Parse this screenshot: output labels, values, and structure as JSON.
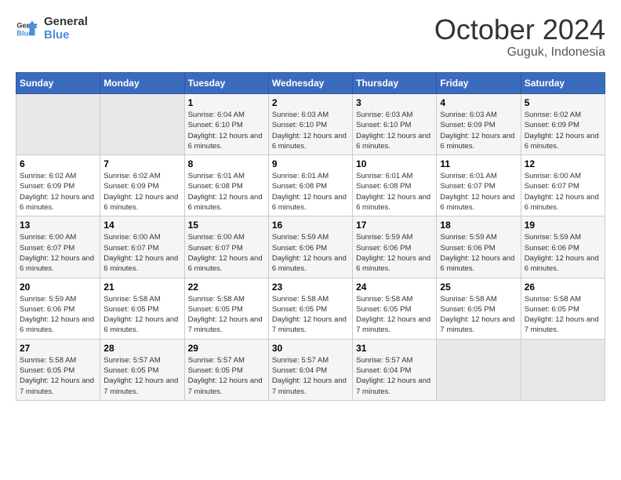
{
  "header": {
    "logo_line1": "General",
    "logo_line2": "Blue",
    "month": "October 2024",
    "location": "Guguk, Indonesia"
  },
  "days_of_week": [
    "Sunday",
    "Monday",
    "Tuesday",
    "Wednesday",
    "Thursday",
    "Friday",
    "Saturday"
  ],
  "weeks": [
    [
      {
        "day": "",
        "empty": true
      },
      {
        "day": "",
        "empty": true
      },
      {
        "day": "1",
        "sunrise": "6:04 AM",
        "sunset": "6:10 PM",
        "daylight": "12 hours and 6 minutes."
      },
      {
        "day": "2",
        "sunrise": "6:03 AM",
        "sunset": "6:10 PM",
        "daylight": "12 hours and 6 minutes."
      },
      {
        "day": "3",
        "sunrise": "6:03 AM",
        "sunset": "6:10 PM",
        "daylight": "12 hours and 6 minutes."
      },
      {
        "day": "4",
        "sunrise": "6:03 AM",
        "sunset": "6:09 PM",
        "daylight": "12 hours and 6 minutes."
      },
      {
        "day": "5",
        "sunrise": "6:02 AM",
        "sunset": "6:09 PM",
        "daylight": "12 hours and 6 minutes."
      }
    ],
    [
      {
        "day": "6",
        "sunrise": "6:02 AM",
        "sunset": "6:09 PM",
        "daylight": "12 hours and 6 minutes."
      },
      {
        "day": "7",
        "sunrise": "6:02 AM",
        "sunset": "6:09 PM",
        "daylight": "12 hours and 6 minutes."
      },
      {
        "day": "8",
        "sunrise": "6:01 AM",
        "sunset": "6:08 PM",
        "daylight": "12 hours and 6 minutes."
      },
      {
        "day": "9",
        "sunrise": "6:01 AM",
        "sunset": "6:08 PM",
        "daylight": "12 hours and 6 minutes."
      },
      {
        "day": "10",
        "sunrise": "6:01 AM",
        "sunset": "6:08 PM",
        "daylight": "12 hours and 6 minutes."
      },
      {
        "day": "11",
        "sunrise": "6:01 AM",
        "sunset": "6:07 PM",
        "daylight": "12 hours and 6 minutes."
      },
      {
        "day": "12",
        "sunrise": "6:00 AM",
        "sunset": "6:07 PM",
        "daylight": "12 hours and 6 minutes."
      }
    ],
    [
      {
        "day": "13",
        "sunrise": "6:00 AM",
        "sunset": "6:07 PM",
        "daylight": "12 hours and 6 minutes."
      },
      {
        "day": "14",
        "sunrise": "6:00 AM",
        "sunset": "6:07 PM",
        "daylight": "12 hours and 6 minutes."
      },
      {
        "day": "15",
        "sunrise": "6:00 AM",
        "sunset": "6:07 PM",
        "daylight": "12 hours and 6 minutes."
      },
      {
        "day": "16",
        "sunrise": "5:59 AM",
        "sunset": "6:06 PM",
        "daylight": "12 hours and 6 minutes."
      },
      {
        "day": "17",
        "sunrise": "5:59 AM",
        "sunset": "6:06 PM",
        "daylight": "12 hours and 6 minutes."
      },
      {
        "day": "18",
        "sunrise": "5:59 AM",
        "sunset": "6:06 PM",
        "daylight": "12 hours and 6 minutes."
      },
      {
        "day": "19",
        "sunrise": "5:59 AM",
        "sunset": "6:06 PM",
        "daylight": "12 hours and 6 minutes."
      }
    ],
    [
      {
        "day": "20",
        "sunrise": "5:59 AM",
        "sunset": "6:06 PM",
        "daylight": "12 hours and 6 minutes."
      },
      {
        "day": "21",
        "sunrise": "5:58 AM",
        "sunset": "6:05 PM",
        "daylight": "12 hours and 6 minutes."
      },
      {
        "day": "22",
        "sunrise": "5:58 AM",
        "sunset": "6:05 PM",
        "daylight": "12 hours and 7 minutes."
      },
      {
        "day": "23",
        "sunrise": "5:58 AM",
        "sunset": "6:05 PM",
        "daylight": "12 hours and 7 minutes."
      },
      {
        "day": "24",
        "sunrise": "5:58 AM",
        "sunset": "6:05 PM",
        "daylight": "12 hours and 7 minutes."
      },
      {
        "day": "25",
        "sunrise": "5:58 AM",
        "sunset": "6:05 PM",
        "daylight": "12 hours and 7 minutes."
      },
      {
        "day": "26",
        "sunrise": "5:58 AM",
        "sunset": "6:05 PM",
        "daylight": "12 hours and 7 minutes."
      }
    ],
    [
      {
        "day": "27",
        "sunrise": "5:58 AM",
        "sunset": "6:05 PM",
        "daylight": "12 hours and 7 minutes."
      },
      {
        "day": "28",
        "sunrise": "5:57 AM",
        "sunset": "6:05 PM",
        "daylight": "12 hours and 7 minutes."
      },
      {
        "day": "29",
        "sunrise": "5:57 AM",
        "sunset": "6:05 PM",
        "daylight": "12 hours and 7 minutes."
      },
      {
        "day": "30",
        "sunrise": "5:57 AM",
        "sunset": "6:04 PM",
        "daylight": "12 hours and 7 minutes."
      },
      {
        "day": "31",
        "sunrise": "5:57 AM",
        "sunset": "6:04 PM",
        "daylight": "12 hours and 7 minutes."
      },
      {
        "day": "",
        "empty": true
      },
      {
        "day": "",
        "empty": true
      }
    ]
  ],
  "labels": {
    "sunrise": "Sunrise:",
    "sunset": "Sunset:",
    "daylight": "Daylight:"
  }
}
